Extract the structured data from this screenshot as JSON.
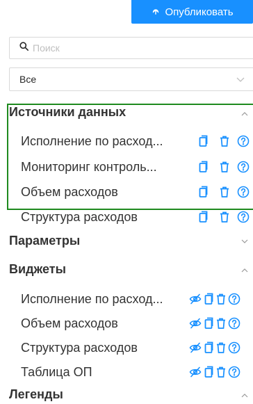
{
  "toolbar": {
    "publish_label": "Опубликовать"
  },
  "search": {
    "placeholder": "Поиск",
    "value": ""
  },
  "filter": {
    "selected": "Все"
  },
  "sections": {
    "data_sources": {
      "title": "Источники данных",
      "items": [
        "Исполнение по расход...",
        "Мониторинг контроль...",
        "Объем расходов",
        "Структура расходов"
      ]
    },
    "parameters": {
      "title": "Параметры"
    },
    "widgets": {
      "title": "Виджеты",
      "items": [
        "Исполнение по расход...",
        "Объем расходов",
        "Структура расходов",
        "Таблица ОП"
      ]
    },
    "legends": {
      "title": "Легенды"
    }
  },
  "colors": {
    "accent": "#1890ff",
    "highlight_border": "#1e8a1e",
    "text": "#333333",
    "muted": "#bfbfbf"
  },
  "icons": [
    "upload-icon",
    "search-icon",
    "chevron-down-icon",
    "chevron-up-icon",
    "copy-icon",
    "delete-icon",
    "help-icon",
    "eye-off-icon"
  ]
}
